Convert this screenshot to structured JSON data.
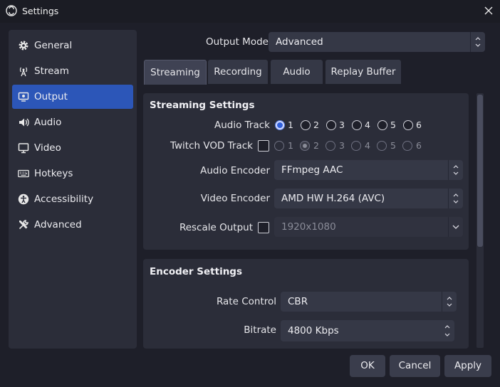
{
  "window": {
    "title": "Settings"
  },
  "sidebar": {
    "items": [
      {
        "label": "General",
        "icon": "gear-icon"
      },
      {
        "label": "Stream",
        "icon": "antenna-icon"
      },
      {
        "label": "Output",
        "icon": "output-icon",
        "active": true
      },
      {
        "label": "Audio",
        "icon": "speaker-icon"
      },
      {
        "label": "Video",
        "icon": "monitor-icon"
      },
      {
        "label": "Hotkeys",
        "icon": "keyboard-icon"
      },
      {
        "label": "Accessibility",
        "icon": "accessibility-icon"
      },
      {
        "label": "Advanced",
        "icon": "tools-icon"
      }
    ]
  },
  "output_mode": {
    "label": "Output Mode",
    "value": "Advanced"
  },
  "tabs": [
    {
      "label": "Streaming",
      "active": true
    },
    {
      "label": "Recording"
    },
    {
      "label": "Audio"
    },
    {
      "label": "Replay Buffer"
    }
  ],
  "streaming": {
    "title": "Streaming Settings",
    "audio_track": {
      "label": "Audio Track",
      "options": [
        "1",
        "2",
        "3",
        "4",
        "5",
        "6"
      ],
      "selected": "1"
    },
    "twitch_vod": {
      "label": "Twitch VOD Track",
      "checked": false,
      "options": [
        "1",
        "2",
        "3",
        "4",
        "5",
        "6"
      ],
      "selected": "2"
    },
    "audio_encoder": {
      "label": "Audio Encoder",
      "value": "FFmpeg AAC"
    },
    "video_encoder": {
      "label": "Video Encoder",
      "value": "AMD HW H.264 (AVC)"
    },
    "rescale": {
      "label": "Rescale Output",
      "checked": false,
      "value": "1920x1080"
    }
  },
  "encoder": {
    "title": "Encoder Settings",
    "rate_control": {
      "label": "Rate Control",
      "value": "CBR"
    },
    "bitrate": {
      "label": "Bitrate",
      "value": "4800 Kbps"
    }
  },
  "buttons": {
    "ok": "OK",
    "cancel": "Cancel",
    "apply": "Apply"
  },
  "colors": {
    "accent": "#2c56b8",
    "background": "#1e1f29",
    "panel": "#2b2d39",
    "control": "#353846"
  }
}
